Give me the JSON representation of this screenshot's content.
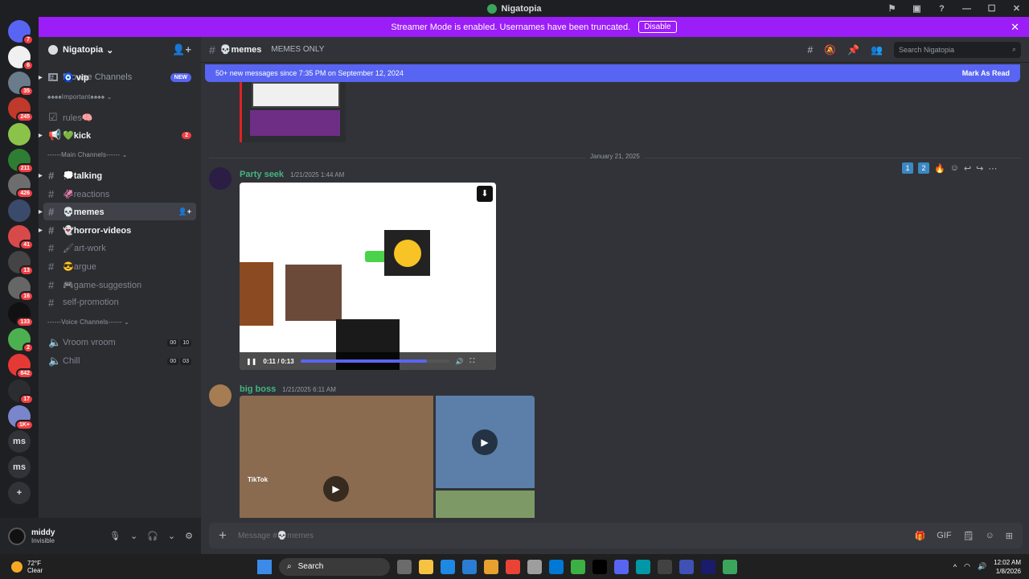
{
  "window": {
    "title": "Nigatopia",
    "controls": [
      "⚑",
      "▣",
      "?",
      "—",
      "☐",
      "✕"
    ]
  },
  "streamer_banner": {
    "text": "Streamer Mode is enabled. Usernames have been truncated.",
    "button": "Disable",
    "close": "✕"
  },
  "servers": [
    {
      "label": "",
      "badge": "7",
      "color": "#5865f2"
    },
    {
      "label": "",
      "badge": "6",
      "color": "#f0f0f0"
    },
    {
      "label": "",
      "badge": "35",
      "color": "#6a7b8c"
    },
    {
      "label": "",
      "badge": "245",
      "color": "#c0392b"
    },
    {
      "label": "",
      "badge": "",
      "color": "#8bc34a"
    },
    {
      "label": "",
      "badge": "211",
      "color": "#2e7d32"
    },
    {
      "label": "",
      "badge": "426",
      "color": "#6d6d6d"
    },
    {
      "label": "",
      "badge": "",
      "color": "#3a4a6a"
    },
    {
      "label": "",
      "badge": "41",
      "color": "#d84a4a"
    },
    {
      "label": "",
      "badge": "13",
      "color": "#444"
    },
    {
      "label": "",
      "badge": "16",
      "color": "#666"
    },
    {
      "label": "",
      "badge": "133",
      "color": "#111"
    },
    {
      "label": "",
      "badge": "2",
      "color": "#4caf50"
    },
    {
      "label": "",
      "badge": "842",
      "color": "#e53935"
    },
    {
      "label": "",
      "badge": "17",
      "color": "#2b2d31"
    },
    {
      "label": "",
      "badge": "1K+",
      "color": "#7986cb"
    },
    {
      "label": "ms",
      "badge": ""
    },
    {
      "label": "ms",
      "badge": ""
    },
    {
      "label": "+",
      "badge": ""
    }
  ],
  "guild": {
    "name": "Nigatopia",
    "chevron": "⌄",
    "invite_icon": "👤+"
  },
  "browse": {
    "label": "Browse Channels",
    "badge": "NEW"
  },
  "channels": [
    {
      "type": "text",
      "name": "🧿 vip",
      "style": "bold",
      "arrow": true
    },
    {
      "type": "category",
      "name": "♠♠♠♠Important♠♠♠♠ ⌄"
    },
    {
      "type": "rules",
      "name": "rules🧠",
      "style": "muted"
    },
    {
      "type": "announce",
      "name": "💚kick",
      "style": "bold",
      "arrow": true,
      "mention": "2"
    },
    {
      "type": "category",
      "name": "------Main Channels------ ⌄"
    },
    {
      "type": "text",
      "name": "💭talking",
      "style": "bold",
      "arrow": true
    },
    {
      "type": "text",
      "name": "🦑reactions",
      "style": "muted"
    },
    {
      "type": "text",
      "name": "💀memes",
      "style": "active",
      "arrow": true
    },
    {
      "type": "text",
      "name": "👻horror-videos",
      "style": "bold",
      "arrow": true
    },
    {
      "type": "text",
      "name": "🖌art-work",
      "style": "muted"
    },
    {
      "type": "text",
      "name": "😎argue",
      "style": "muted"
    },
    {
      "type": "text",
      "name": "🎮game-suggestion",
      "style": "muted"
    },
    {
      "type": "text",
      "name": "self-promotion",
      "style": "muted"
    },
    {
      "type": "category",
      "name": "------Voice Channels------ ⌄"
    },
    {
      "type": "voice",
      "name": "Vroom vroom",
      "style": "muted",
      "vc": [
        "00",
        "10"
      ]
    },
    {
      "type": "voice",
      "name": "Chill",
      "style": "muted",
      "vc": [
        "00",
        "03"
      ]
    }
  ],
  "user": {
    "name": "middy",
    "status": "Invisible",
    "controls": [
      "🎙",
      "⌄",
      "🎧",
      "⌄",
      "⚙"
    ]
  },
  "chat_header": {
    "channel": "💀memes",
    "topic": "MEMES ONLY",
    "search_placeholder": "Search Nigatopia",
    "tools": [
      "#",
      "🔕",
      "📌",
      "👥"
    ]
  },
  "new_messages": {
    "text": "50+ new messages since 7:35 PM on September 12, 2024",
    "action": "Mark As Read"
  },
  "date_divider": "January 21, 2025",
  "messages": [
    {
      "author": "Party seek",
      "timestamp": "1/21/2025 1:44 AM",
      "color": "#43b581",
      "video": {
        "time": "0:11 / 0:13",
        "progress": 0.85
      }
    },
    {
      "author": "big boss",
      "timestamp": "1/21/2025 6:11 AM",
      "color": "#43b581",
      "tiktok": "TikTok"
    }
  ],
  "hover_tools": [
    "1",
    "2",
    "🔥",
    "☺",
    "↩",
    "↪",
    "⋯"
  ],
  "composer": {
    "placeholder": "Message #💀memes",
    "plus": "+",
    "icons": [
      "🎁",
      "GIF",
      "🗒",
      "☺",
      "⊞"
    ]
  },
  "taskbar": {
    "weather_temp": "72°F",
    "weather_desc": "Clear",
    "search": "Search",
    "time": "12:02 AM",
    "date": "1/8/2026",
    "apps": [
      "#6b6b6b",
      "#f5c242",
      "#1e88e5",
      "#2b7cd3",
      "#e8a02f",
      "#ea4335",
      "#9e9e9e",
      "#0078d4",
      "#3cb043",
      "#000000",
      "#5865f2",
      "#0097a7",
      "#424242",
      "#3f51b5",
      "#1b1b6b",
      "#3ba55c"
    ]
  }
}
